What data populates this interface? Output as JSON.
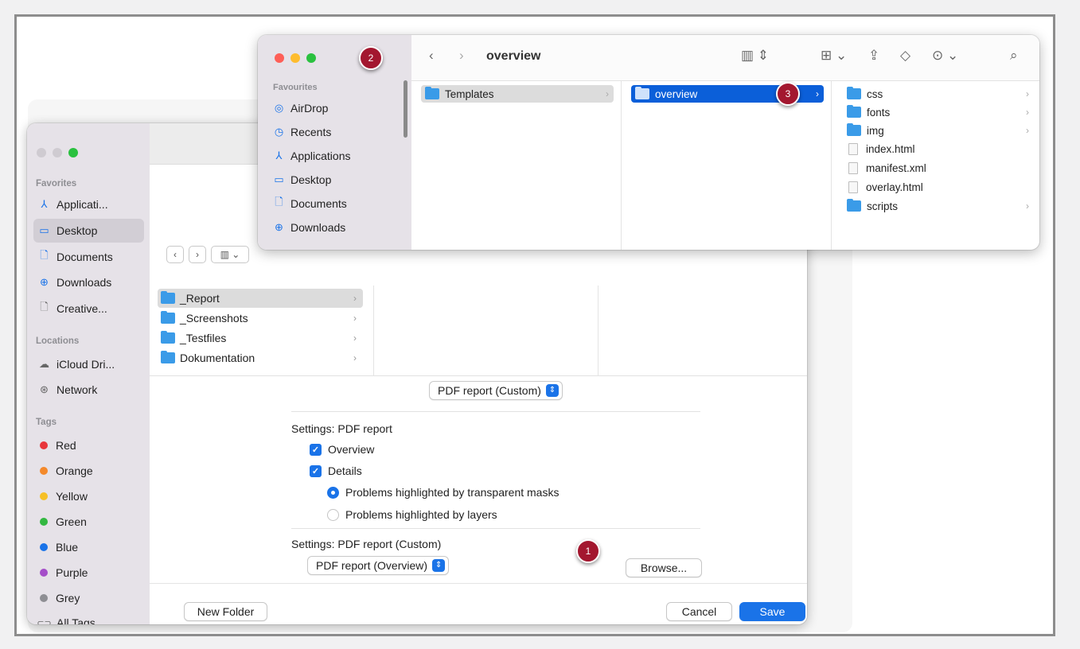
{
  "dialog": {
    "sidebar": {
      "favorites_heading": "Favorites",
      "favorites": [
        {
          "label": "Applicati...",
          "icon": "applications-icon"
        },
        {
          "label": "Desktop",
          "icon": "desktop-icon"
        },
        {
          "label": "Documents",
          "icon": "document-icon"
        },
        {
          "label": "Downloads",
          "icon": "download-icon"
        },
        {
          "label": "Creative...",
          "icon": "file-icon"
        }
      ],
      "locations_heading": "Locations",
      "locations": [
        {
          "label": "iCloud Dri...",
          "icon": "cloud-icon"
        },
        {
          "label": "Network",
          "icon": "network-icon"
        }
      ],
      "tags_heading": "Tags",
      "tags": [
        {
          "label": "Red",
          "color": "#e8353b"
        },
        {
          "label": "Orange",
          "color": "#f4892b"
        },
        {
          "label": "Yellow",
          "color": "#f6c026"
        },
        {
          "label": "Green",
          "color": "#33b841"
        },
        {
          "label": "Blue",
          "color": "#1a73e8"
        },
        {
          "label": "Purple",
          "color": "#a54ec9"
        },
        {
          "label": "Grey",
          "color": "#8e8e93"
        },
        {
          "label": "All Tags...",
          "color": ""
        }
      ]
    },
    "columns": [
      {
        "label": "_Report",
        "selected": true
      },
      {
        "label": "_Screenshots"
      },
      {
        "label": "_Testfiles"
      },
      {
        "label": "Dokumentation"
      }
    ],
    "format_popup": "PDF report (Custom)",
    "settings_pdf_title": "Settings: PDF report",
    "overview_label": "Overview",
    "details_label": "Details",
    "radio_masks": "Problems highlighted by transparent masks",
    "radio_layers": "Problems highlighted by layers",
    "settings_custom_title": "Settings: PDF report (Custom)",
    "custom_popup": "PDF report (Overview)",
    "browse_button": "Browse...",
    "new_folder_button": "New Folder",
    "cancel_button": "Cancel",
    "save_button": "Save"
  },
  "finder": {
    "favourites_heading": "Favourites",
    "favourites": [
      {
        "label": "AirDrop",
        "icon": "airdrop-icon"
      },
      {
        "label": "Recents",
        "icon": "clock-icon"
      },
      {
        "label": "Applications",
        "icon": "applications-icon"
      },
      {
        "label": "Desktop",
        "icon": "desktop-icon"
      },
      {
        "label": "Documents",
        "icon": "document-icon"
      },
      {
        "label": "Downloads",
        "icon": "download-icon"
      }
    ],
    "title": "overview",
    "column1": [
      {
        "label": "Templates",
        "type": "folder"
      }
    ],
    "column2": [
      {
        "label": "overview",
        "type": "folder"
      }
    ],
    "column3": [
      {
        "label": "css",
        "type": "folder"
      },
      {
        "label": "fonts",
        "type": "folder"
      },
      {
        "label": "img",
        "type": "folder"
      },
      {
        "label": "index.html",
        "type": "file"
      },
      {
        "label": "manifest.xml",
        "type": "file"
      },
      {
        "label": "overlay.html",
        "type": "file"
      },
      {
        "label": "scripts",
        "type": "folder"
      }
    ]
  },
  "badges": {
    "one": "1",
    "two": "2",
    "three": "3"
  }
}
